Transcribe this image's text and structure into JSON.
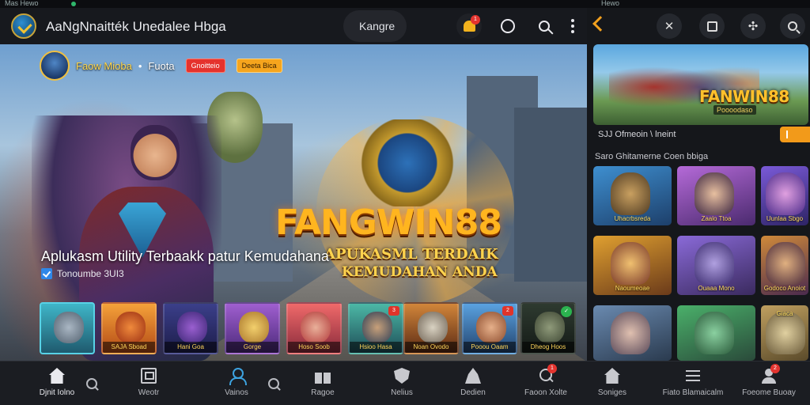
{
  "status_bar": {
    "left": "Mas Hewo",
    "right": "Hewo"
  },
  "app": {
    "title": "AaNgNnaitték Unedalee Hbga",
    "category_label": "Kangre",
    "notification_count": "1"
  },
  "hero": {
    "channel_name": "Faow Mioba",
    "separator": "•",
    "channel_sub": "Fuota",
    "pill_red": "Gnoitteio",
    "pill_gold": "Deeta Bica",
    "brand": "FANGWIN88",
    "tagline_line1": "APUKASML TERDAIK",
    "tagline_line2": "KEMUDAHAN ANDA",
    "title": "Aplukasm Utility Terbaakk patur Kemudahana",
    "meta": "Tonoumbe 3UI3"
  },
  "thumbnails": [
    {
      "caption": "",
      "tag": ""
    },
    {
      "caption": "SAJA Sboad",
      "tag": ""
    },
    {
      "caption": "Hani Goa",
      "tag": ""
    },
    {
      "caption": "Gorge",
      "tag": ""
    },
    {
      "caption": "Hoso Soob",
      "tag": ""
    },
    {
      "caption": "Hsioo Hasa",
      "tag": "3"
    },
    {
      "caption": "Noan Ovodo",
      "tag": ""
    },
    {
      "caption": "Pooou Oaam",
      "tag": "2"
    },
    {
      "caption": "Dheog Hoos",
      "tag": "✓"
    }
  ],
  "right_pane": {
    "feature_brand": "FANWIN88",
    "feature_sub": "Poooodaso",
    "feature_caption": "SJJ Ofmeoin \\ lneint",
    "section_title": "Saro Ghitamerne Coen bbiga",
    "tiles": [
      {
        "caption": "Uhacrbsreda"
      },
      {
        "caption": "Zaalo Ttoa"
      },
      {
        "caption": "Uunlaa Sbgo"
      },
      {
        "caption": "Naoumeoae"
      },
      {
        "caption": "Ouaaa Mono"
      },
      {
        "caption": "Godoco Anoiot"
      },
      {
        "caption": ""
      },
      {
        "caption": ""
      },
      {
        "caption": "Giaca"
      }
    ]
  },
  "bottom_nav": [
    {
      "label": "Djnit Iolno",
      "icon": "home-icon"
    },
    {
      "label": "Weotr",
      "icon": "flag-icon"
    },
    {
      "label": "Vainos",
      "icon": "user-icon"
    },
    {
      "label": "Ragoe",
      "icon": "gift-icon"
    },
    {
      "label": "Nelius",
      "icon": "shield-icon"
    },
    {
      "label": "Dedien",
      "icon": "pin-icon"
    },
    {
      "label": "Faoon Xolte",
      "icon": "search-icon",
      "badge": "1"
    },
    {
      "label": "Soniges",
      "icon": "home-icon"
    },
    {
      "label": "Fiato Blamaicalm",
      "icon": "menu-icon"
    },
    {
      "label": "Foeome Buoay",
      "icon": "person-icon",
      "badge": "2"
    }
  ]
}
